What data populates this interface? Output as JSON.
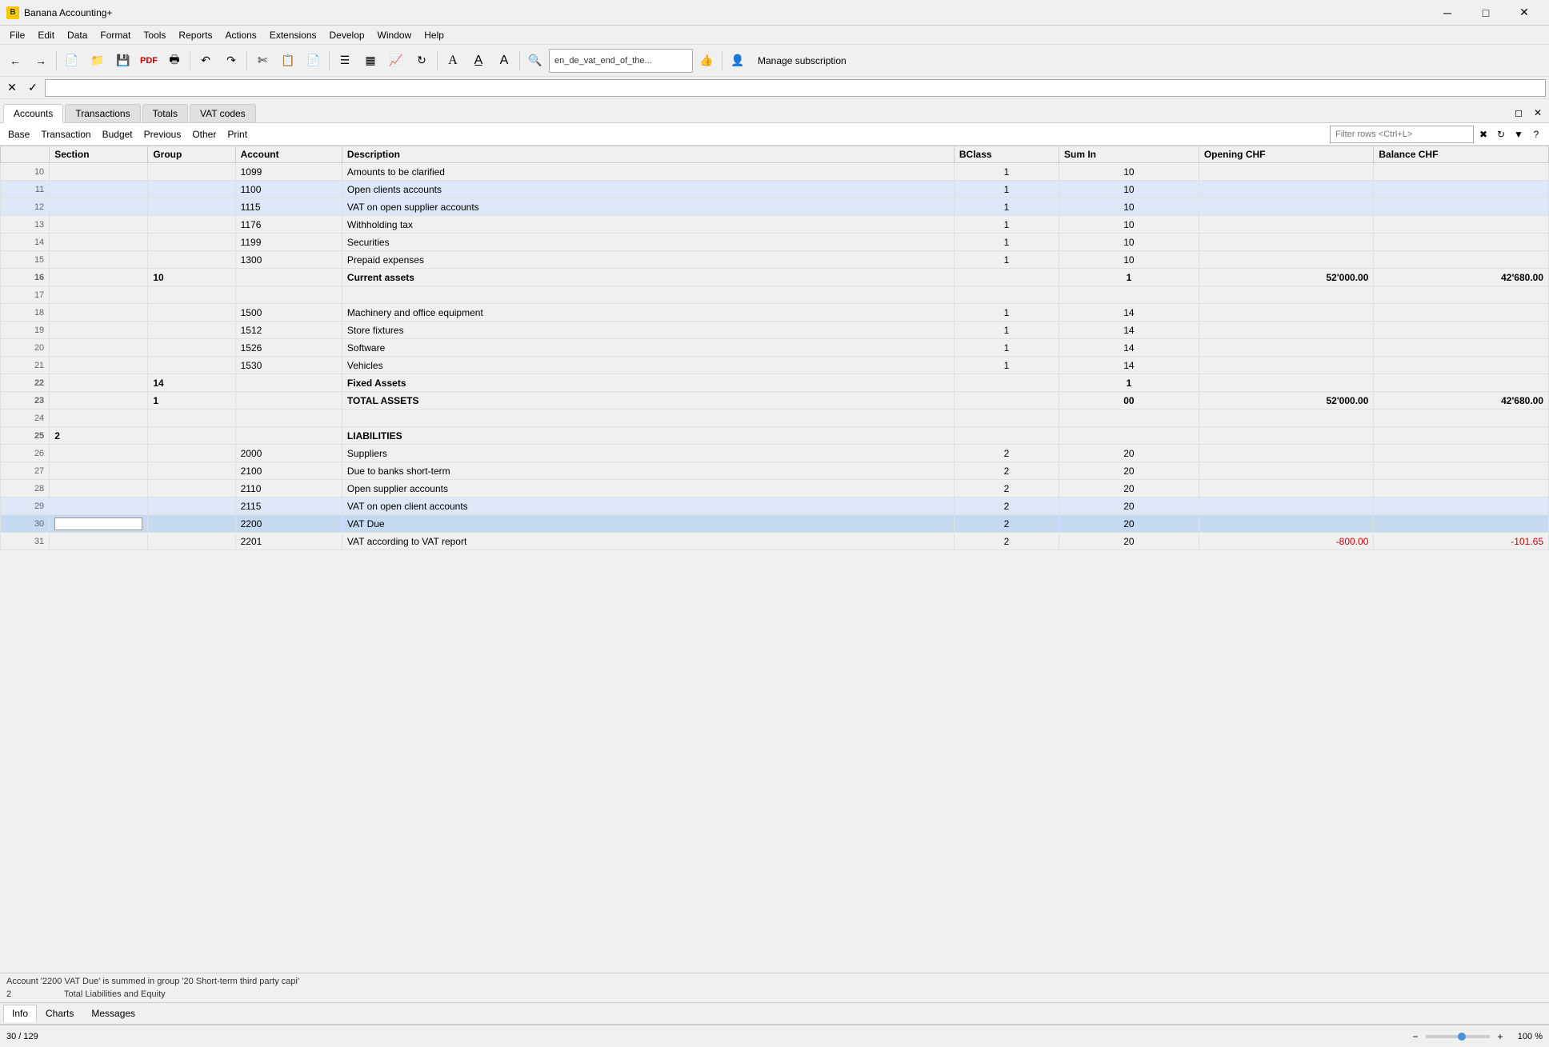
{
  "app": {
    "title": "Banana Accounting+",
    "icon": "B"
  },
  "window_controls": {
    "minimize": "─",
    "maximize": "□",
    "close": "✕"
  },
  "menu": {
    "items": [
      "File",
      "Edit",
      "Data",
      "Format",
      "Tools",
      "Reports",
      "Actions",
      "Extensions",
      "Develop",
      "Window",
      "Help"
    ]
  },
  "toolbar": {
    "filename": "en_de_vat_end_of_the...",
    "manage_subscription": "Manage subscription",
    "filter_placeholder": "Filter rows <Ctrl+L>"
  },
  "tabs": {
    "items": [
      "Accounts",
      "Transactions",
      "Totals",
      "VAT codes"
    ],
    "active": "Accounts"
  },
  "view_links": {
    "items": [
      "Base",
      "Transaction",
      "Budget",
      "Previous",
      "Other",
      "Print"
    ]
  },
  "table": {
    "headers": [
      "",
      "Section",
      "Group",
      "Account",
      "Description",
      "BClass",
      "Sum In",
      "Opening CHF",
      "Balance CHF"
    ],
    "rows": [
      {
        "row": "10",
        "section": "",
        "group": "",
        "account": "1099",
        "desc": "Amounts to be clarified",
        "bclass": "1",
        "sumin": "10",
        "opening": "",
        "balance": "",
        "highlight": false
      },
      {
        "row": "11",
        "section": "",
        "group": "",
        "account": "1100",
        "desc": "Open clients accounts",
        "bclass": "1",
        "sumin": "10",
        "opening": "",
        "balance": "",
        "highlight": true
      },
      {
        "row": "12",
        "section": "",
        "group": "",
        "account": "1115",
        "desc": "VAT on open supplier accounts",
        "bclass": "1",
        "sumin": "10",
        "opening": "",
        "balance": "",
        "highlight": true
      },
      {
        "row": "13",
        "section": "",
        "group": "",
        "account": "1176",
        "desc": "Withholding tax",
        "bclass": "1",
        "sumin": "10",
        "opening": "",
        "balance": "",
        "highlight": false
      },
      {
        "row": "14",
        "section": "",
        "group": "",
        "account": "1199",
        "desc": "Securities",
        "bclass": "1",
        "sumin": "10",
        "opening": "",
        "balance": "",
        "highlight": false
      },
      {
        "row": "15",
        "section": "",
        "group": "",
        "account": "1300",
        "desc": "Prepaid expenses",
        "bclass": "1",
        "sumin": "10",
        "opening": "",
        "balance": "",
        "highlight": false
      },
      {
        "row": "16",
        "section": "",
        "group": "10",
        "account": "",
        "desc": "Current assets",
        "bclass": "",
        "sumin": "1",
        "opening": "52'000.00",
        "balance": "42'680.00",
        "highlight": false,
        "bold": true
      },
      {
        "row": "17",
        "section": "",
        "group": "",
        "account": "",
        "desc": "",
        "bclass": "",
        "sumin": "",
        "opening": "",
        "balance": "",
        "highlight": false
      },
      {
        "row": "18",
        "section": "",
        "group": "",
        "account": "1500",
        "desc": "Machinery and office equipment",
        "bclass": "1",
        "sumin": "14",
        "opening": "",
        "balance": "",
        "highlight": false
      },
      {
        "row": "19",
        "section": "",
        "group": "",
        "account": "1512",
        "desc": "Store fixtures",
        "bclass": "1",
        "sumin": "14",
        "opening": "",
        "balance": "",
        "highlight": false
      },
      {
        "row": "20",
        "section": "",
        "group": "",
        "account": "1526",
        "desc": "Software",
        "bclass": "1",
        "sumin": "14",
        "opening": "",
        "balance": "",
        "highlight": false
      },
      {
        "row": "21",
        "section": "",
        "group": "",
        "account": "1530",
        "desc": "Vehicles",
        "bclass": "1",
        "sumin": "14",
        "opening": "",
        "balance": "",
        "highlight": false
      },
      {
        "row": "22",
        "section": "",
        "group": "14",
        "account": "",
        "desc": "Fixed Assets",
        "bclass": "",
        "sumin": "1",
        "opening": "",
        "balance": "",
        "highlight": false,
        "bold": true
      },
      {
        "row": "23",
        "section": "",
        "group": "1",
        "account": "",
        "desc": "TOTAL ASSETS",
        "bclass": "",
        "sumin": "00",
        "opening": "52'000.00",
        "balance": "42'680.00",
        "highlight": false,
        "bold": true
      },
      {
        "row": "24",
        "section": "",
        "group": "",
        "account": "",
        "desc": "",
        "bclass": "",
        "sumin": "",
        "opening": "",
        "balance": "",
        "highlight": false
      },
      {
        "row": "25",
        "section": "2",
        "group": "",
        "account": "",
        "desc": "LIABILITIES",
        "bclass": "",
        "sumin": "",
        "opening": "",
        "balance": "",
        "highlight": false,
        "bold": true
      },
      {
        "row": "26",
        "section": "",
        "group": "",
        "account": "2000",
        "desc": "Suppliers",
        "bclass": "2",
        "sumin": "20",
        "opening": "",
        "balance": "",
        "highlight": false
      },
      {
        "row": "27",
        "section": "",
        "group": "",
        "account": "2100",
        "desc": "Due to banks short-term",
        "bclass": "2",
        "sumin": "20",
        "opening": "",
        "balance": "",
        "highlight": false
      },
      {
        "row": "28",
        "section": "",
        "group": "",
        "account": "2110",
        "desc": "Open supplier accounts",
        "bclass": "2",
        "sumin": "20",
        "opening": "",
        "balance": "",
        "highlight": false
      },
      {
        "row": "29",
        "section": "",
        "group": "",
        "account": "2115",
        "desc": "VAT on open client accounts",
        "bclass": "2",
        "sumin": "20",
        "opening": "",
        "balance": "",
        "highlight": true
      },
      {
        "row": "30",
        "section": "",
        "group": "",
        "account": "2200",
        "desc": "VAT Due",
        "bclass": "2",
        "sumin": "20",
        "opening": "",
        "balance": "",
        "highlight": false,
        "selected": true
      },
      {
        "row": "31",
        "section": "",
        "group": "",
        "account": "2201",
        "desc": "VAT according to VAT report",
        "bclass": "2",
        "sumin": "20",
        "opening": "-800.00",
        "balance": "-101.65",
        "highlight": false,
        "negative_opening": true,
        "negative_balance": true
      }
    ]
  },
  "status": {
    "line1": "Account '2200 VAT Due' is summed in group '20 Short-term third party capi'",
    "line2_num": "2",
    "line2_desc": "Total Liabilities and Equity"
  },
  "bottom_tabs": {
    "items": [
      "Info",
      "Charts",
      "Messages"
    ],
    "active": "Info"
  },
  "zoom": {
    "position": "30 / 129",
    "percentage": "100 %"
  }
}
